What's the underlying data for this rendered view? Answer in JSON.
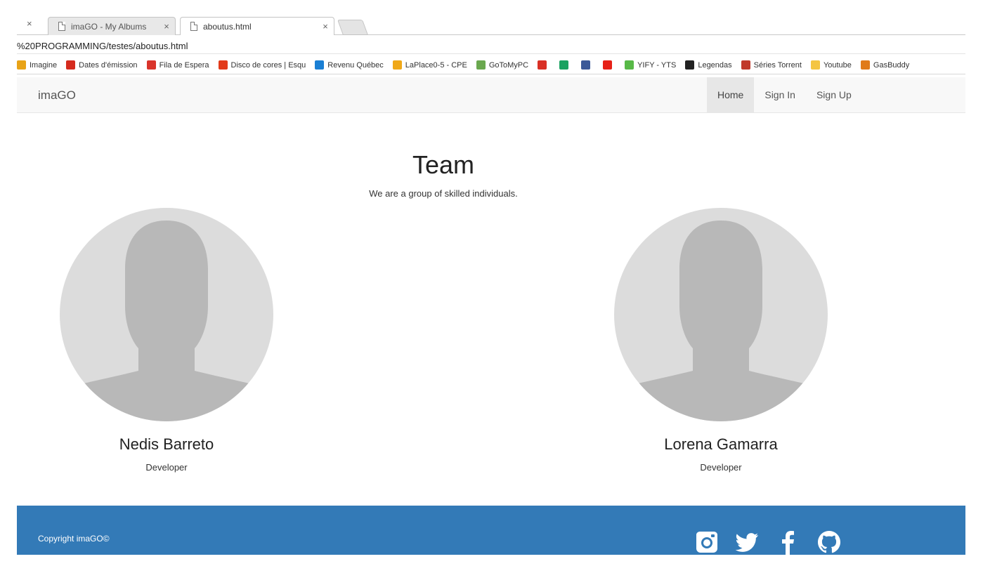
{
  "browser": {
    "tabs": [
      {
        "label": "imaGO - My Albums",
        "close": "×"
      },
      {
        "label": "aboutus.html",
        "close": "×"
      }
    ],
    "lead_close": "×",
    "url": "%20PROGRAMMING/testes/aboutus.html",
    "bookmarks": [
      {
        "label": "Imagine",
        "color": "#e8a317"
      },
      {
        "label": "Dates d'émission",
        "color": "#d52b1e"
      },
      {
        "label": "Fila de Espera",
        "color": "#d9342b"
      },
      {
        "label": "Disco de cores | Esqu",
        "color": "#e23a1a"
      },
      {
        "label": "Revenu Québec",
        "color": "#1a7fd4"
      },
      {
        "label": "LaPlace0-5 - CPE",
        "color": "#f0a818"
      },
      {
        "label": "GoToMyPC",
        "color": "#6aa84f"
      },
      {
        "label": "",
        "color": "#d93025"
      },
      {
        "label": "",
        "color": "#1aa260"
      },
      {
        "label": "",
        "color": "#3b5998"
      },
      {
        "label": "",
        "color": "#e62117"
      },
      {
        "label": "YIFY - YTS",
        "color": "#58b947"
      },
      {
        "label": "Legendas",
        "color": "#222222"
      },
      {
        "label": "Séries Torrent",
        "color": "#c0392b"
      },
      {
        "label": "Youtube",
        "color": "#f4c542"
      },
      {
        "label": "GasBuddy",
        "color": "#e07b1a"
      }
    ]
  },
  "navbar": {
    "brand": "imaGO",
    "links": [
      {
        "label": "Home"
      },
      {
        "label": "Sign In"
      },
      {
        "label": "Sign Up"
      }
    ]
  },
  "team": {
    "title": "Team",
    "subtitle": "We are a group of skilled individuals.",
    "members": [
      {
        "name": "Nedis Barreto",
        "role": "Developer"
      },
      {
        "name": "Lorena Gamarra",
        "role": "Developer"
      }
    ]
  },
  "footer": {
    "copyright": "Copyright imaGO©",
    "social": [
      "instagram-icon",
      "twitter-icon",
      "facebook-icon",
      "github-icon"
    ]
  },
  "colors": {
    "footer_bg": "#337ab7",
    "navbar_bg": "#f8f8f8",
    "avatar_bg": "#dcdcdc",
    "avatar_silhouette": "#b8b8b8"
  }
}
